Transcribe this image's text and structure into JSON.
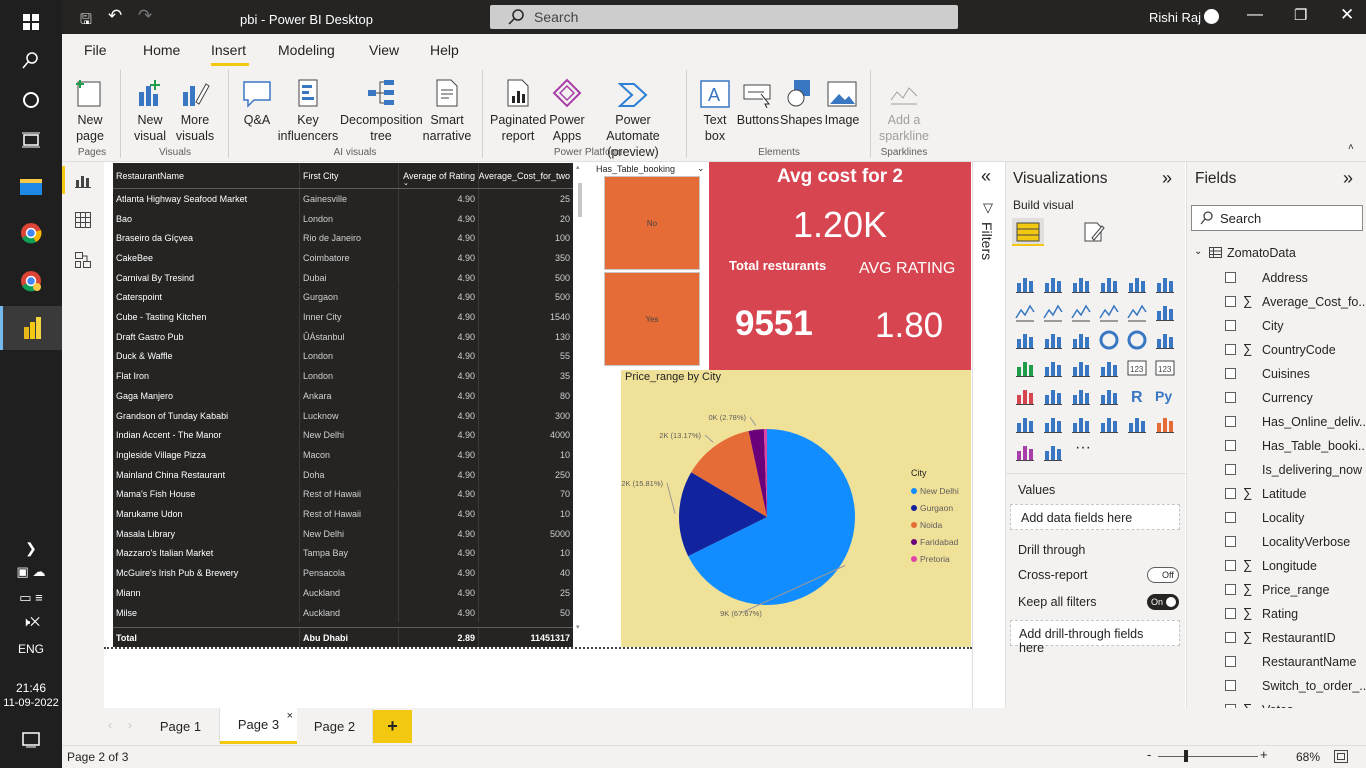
{
  "window": {
    "title": "pbi - Power BI Desktop",
    "search_placeholder": "Search",
    "user": "Rishi Raj"
  },
  "taskbar": {
    "lang": "ENG",
    "time": "21:46",
    "date": "11-09-2022"
  },
  "menu": [
    "File",
    "Home",
    "Insert",
    "Modeling",
    "View",
    "Help"
  ],
  "ribbon": {
    "pages": {
      "new_page": "New page",
      "group": "Pages"
    },
    "visuals": {
      "new_visual": "New visual",
      "more_visuals": "More visuals",
      "group": "Visuals"
    },
    "ai": {
      "qa": "Q&A",
      "key_influencers": "Key influencers",
      "decomposition_tree": "Decomposition tree",
      "smart_narrative": "Smart narrative",
      "group": "AI visuals"
    },
    "power_platform": {
      "paginated_report": "Paginated report",
      "power_apps": "Power Apps",
      "power_automate": "Power Automate (preview)",
      "group": "Power Platform"
    },
    "elements": {
      "text_box": "Text box",
      "buttons": "Buttons",
      "shapes": "Shapes",
      "image": "Image",
      "group": "Elements"
    },
    "sparklines": {
      "add_sparkline": "Add a sparkline",
      "group": "Sparklines"
    }
  },
  "table": {
    "headers": [
      "RestaurantName",
      "First City",
      "Average of Rating",
      "Average_Cost_for_two"
    ],
    "rows": [
      [
        "Atlanta Highway Seafood Market",
        "Gainesville",
        "4.90",
        "25"
      ],
      [
        "Bao",
        "London",
        "4.90",
        "20"
      ],
      [
        "Braseiro da Gíçvea",
        "Rio de Janeiro",
        "4.90",
        "100"
      ],
      [
        "CakeBee",
        "Coimbatore",
        "4.90",
        "350"
      ],
      [
        "Carnival By Tresind",
        "Dubai",
        "4.90",
        "500"
      ],
      [
        "Caterspoint",
        "Gurgaon",
        "4.90",
        "500"
      ],
      [
        "Cube - Tasting Kitchen",
        "Inner City",
        "4.90",
        "1540"
      ],
      [
        "Draft Gastro Pub",
        "ÛÁstanbul",
        "4.90",
        "130"
      ],
      [
        "Duck & Waffle",
        "London",
        "4.90",
        "55"
      ],
      [
        "Flat Iron",
        "London",
        "4.90",
        "35"
      ],
      [
        "Gaga Manjero",
        "Ankara",
        "4.90",
        "80"
      ],
      [
        "Grandson of Tunday Kababi",
        "Lucknow",
        "4.90",
        "300"
      ],
      [
        "Indian Accent - The Manor",
        "New Delhi",
        "4.90",
        "4000"
      ],
      [
        "Ingleside Village Pizza",
        "Macon",
        "4.90",
        "10"
      ],
      [
        "Mainland China Restaurant",
        "Doha",
        "4.90",
        "250"
      ],
      [
        "Mama's Fish House",
        "Rest of Hawaii",
        "4.90",
        "70"
      ],
      [
        "Marukame Udon",
        "Rest of Hawaii",
        "4.90",
        "10"
      ],
      [
        "Masala Library",
        "New Delhi",
        "4.90",
        "5000"
      ],
      [
        "Mazzaro's Italian Market",
        "Tampa Bay",
        "4.90",
        "10"
      ],
      [
        "McGuire's Irish Pub & Brewery",
        "Pensacola",
        "4.90",
        "40"
      ],
      [
        "Miann",
        "Auckland",
        "4.90",
        "25"
      ],
      [
        "Milse",
        "Auckland",
        "4.90",
        "50"
      ]
    ],
    "total": [
      "Total",
      "Abu Dhabi",
      "2.89",
      "11451317"
    ]
  },
  "slicer": {
    "title": "Has_Table_booking",
    "options": [
      "No",
      "Yes"
    ]
  },
  "cards": {
    "avg_cost_title": "Avg cost for 2",
    "avg_cost_value": "1.20K",
    "total_title": "Total resturants",
    "total_value": "9551",
    "rating_title": "AVG RATING",
    "rating_value": "1.80"
  },
  "chart_data": {
    "type": "pie",
    "title": "Price_range by City",
    "legend_title": "City",
    "legend_position": "right",
    "series": [
      {
        "name": "New Delhi",
        "value": 67.67,
        "label": "9K (67.67%)",
        "color": "#118dff"
      },
      {
        "name": "Gurgaon",
        "value": 15.81,
        "label": "2K (15.81%)",
        "color": "#12239e"
      },
      {
        "name": "Noida",
        "value": 13.17,
        "label": "2K (13.17%)",
        "color": "#e66c37"
      },
      {
        "name": "Faridabad",
        "value": 2.78,
        "label": "0K (2.78%)",
        "color": "#6b007b"
      },
      {
        "name": "Pretoria",
        "value": 0.57,
        "label": "",
        "color": "#e044a7"
      }
    ]
  },
  "filters_label": "Filters",
  "viz": {
    "title": "Visualizations",
    "build": "Build visual",
    "values": "Values",
    "add_data": "Add data fields here",
    "drill": "Drill through",
    "cross": "Cross-report",
    "cross_state": "Off",
    "keep": "Keep all filters",
    "keep_state": "On",
    "add_drill": "Add drill-through fields here"
  },
  "fields": {
    "title": "Fields",
    "search": "Search",
    "table": "ZomatoData",
    "items": [
      {
        "name": "Address",
        "sigma": false
      },
      {
        "name": "Average_Cost_fo...",
        "sigma": true
      },
      {
        "name": "City",
        "sigma": false
      },
      {
        "name": "CountryCode",
        "sigma": true
      },
      {
        "name": "Cuisines",
        "sigma": false
      },
      {
        "name": "Currency",
        "sigma": false
      },
      {
        "name": "Has_Online_deliv...",
        "sigma": false
      },
      {
        "name": "Has_Table_booki...",
        "sigma": false
      },
      {
        "name": "Is_delivering_now",
        "sigma": false
      },
      {
        "name": "Latitude",
        "sigma": true
      },
      {
        "name": "Locality",
        "sigma": false
      },
      {
        "name": "LocalityVerbose",
        "sigma": false
      },
      {
        "name": "Longitude",
        "sigma": true
      },
      {
        "name": "Price_range",
        "sigma": true
      },
      {
        "name": "Rating",
        "sigma": true
      },
      {
        "name": "RestaurantID",
        "sigma": true
      },
      {
        "name": "RestaurantName",
        "sigma": false
      },
      {
        "name": "Switch_to_order_...",
        "sigma": false
      },
      {
        "name": "Votes",
        "sigma": true
      }
    ]
  },
  "tabs": [
    "Page 1",
    "Page 3",
    "Page 2"
  ],
  "status": {
    "page": "Page 2 of 3",
    "zoom": "68%"
  },
  "colors": {
    "card_red": "#d64550",
    "slicer_orange": "#e66c37",
    "chart_bg": "#f0e199",
    "accent": "#f2c811"
  }
}
